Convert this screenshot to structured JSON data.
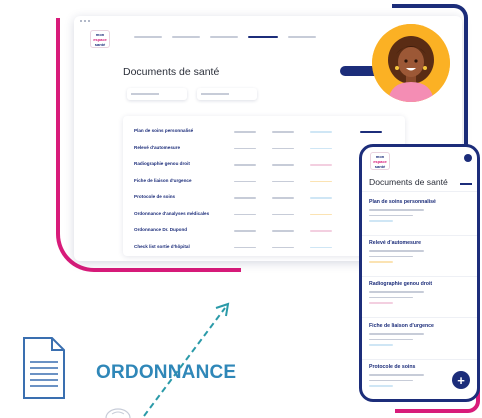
{
  "brand": {
    "logo_line1": "mon",
    "logo_line2": "espace",
    "logo_line3": "santé"
  },
  "laptop": {
    "title": "Documents de santé",
    "documents": [
      {
        "name": "Plan de soins personnalisé",
        "tag_color": "#cfe6f5"
      },
      {
        "name": "Relevé d'automesure",
        "tag_color": "#cfe6f5"
      },
      {
        "name": "Radiographie genou droit",
        "tag_color": "#f3cfe0"
      },
      {
        "name": "Fiche de liaison d'urgence",
        "tag_color": "#fbe3b3"
      },
      {
        "name": "Protocole de soins",
        "tag_color": "#cfe6f5"
      },
      {
        "name": "Ordonnance d'analyses médicales",
        "tag_color": "#fbe3b3"
      },
      {
        "name": "Ordonnance Dr. Dupond",
        "tag_color": "#f3cfe0"
      },
      {
        "name": "Check list sortie d'hôpital",
        "tag_color": "#cfe6f5"
      }
    ]
  },
  "phone": {
    "title": "Documents de santé",
    "documents": [
      {
        "name": "Plan de soins personnalisé",
        "tag_color": "#cfe6f5"
      },
      {
        "name": "Relevé d'automesure",
        "tag_color": "#fbe3b3"
      },
      {
        "name": "Radiographie genou droit",
        "tag_color": "#f3cfe0"
      },
      {
        "name": "Fiche de liaison d'urgence",
        "tag_color": "#cfe6f5"
      },
      {
        "name": "Protocole de soins",
        "tag_color": "#cfe6f5"
      }
    ],
    "fab_label": "+"
  },
  "caption": "ORDONNANCE",
  "colors": {
    "navy": "#1c2d7a",
    "pink": "#d81b7a",
    "caption_blue": "#2f87b8",
    "arrow_teal": "#2a9aa8"
  },
  "icons": [
    "document-icon",
    "avatar",
    "add-icon",
    "arrow-icon"
  ]
}
